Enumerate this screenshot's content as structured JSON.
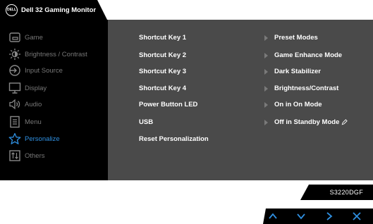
{
  "title_bar": {
    "logo_text": "DELL",
    "title": "Dell 32 Gaming Monitor"
  },
  "sidebar": {
    "items": [
      {
        "label": "Game",
        "icon": "game-icon",
        "active": false
      },
      {
        "label": "Brightness / Contrast",
        "icon": "brightness-icon",
        "active": false
      },
      {
        "label": "Input Source",
        "icon": "input-source-icon",
        "active": false
      },
      {
        "label": "Display",
        "icon": "display-icon",
        "active": false
      },
      {
        "label": "Audio",
        "icon": "audio-icon",
        "active": false
      },
      {
        "label": "Menu",
        "icon": "menu-icon",
        "active": false
      },
      {
        "label": "Personalize",
        "icon": "star-icon",
        "active": true
      },
      {
        "label": "Others",
        "icon": "others-icon",
        "active": false
      }
    ]
  },
  "settings": {
    "rows": [
      {
        "label": "Shortcut Key 1",
        "value": "Preset Modes"
      },
      {
        "label": "Shortcut Key 2",
        "value": "Game Enhance Mode"
      },
      {
        "label": "Shortcut Key 3",
        "value": "Dark Stabilizer"
      },
      {
        "label": "Shortcut Key 4",
        "value": "Brightness/Contrast"
      },
      {
        "label": "Power Button LED",
        "value": "On in On Mode"
      },
      {
        "label": "USB",
        "value": "Off in Standby Mode"
      },
      {
        "label": "Reset Personalization",
        "value": null
      }
    ]
  },
  "model": "S3220DGF",
  "buttons": {
    "up": "up-icon",
    "down": "down-icon",
    "next": "chevron-right-icon",
    "exit": "close-icon"
  },
  "colors": {
    "accent": "#2f8fe0",
    "panel_bg": "#4a4a4a",
    "sidebar_bg": "#000000",
    "inactive_text": "#777777"
  }
}
